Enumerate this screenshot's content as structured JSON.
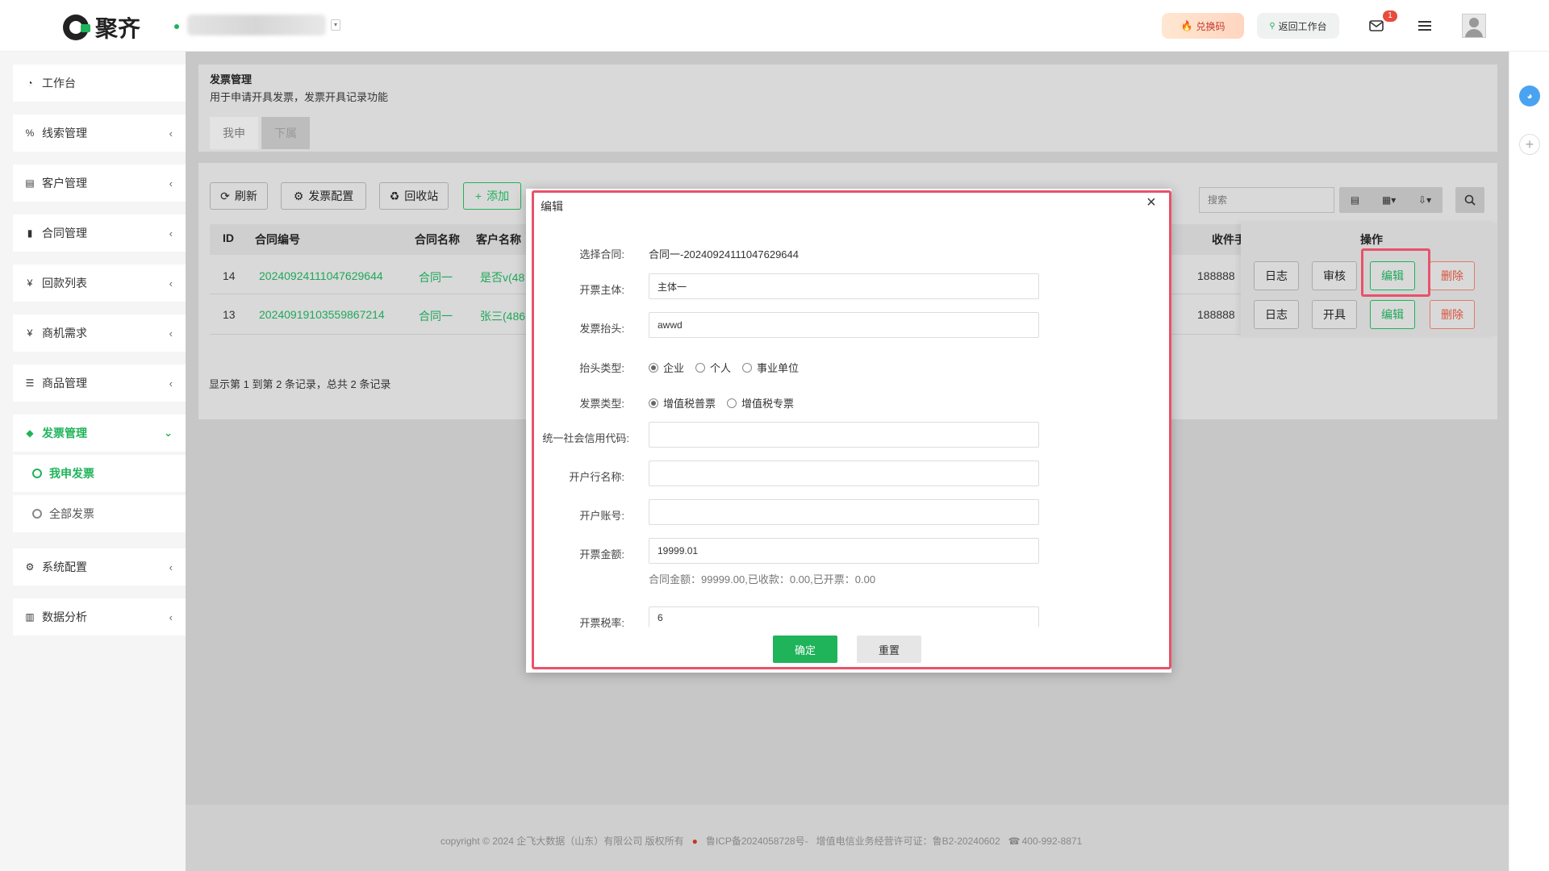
{
  "header": {
    "brand": "聚齐",
    "redeem_label": "兑换码",
    "back_label": "返回工作台",
    "mail_badge": "1"
  },
  "sidebar": {
    "items": [
      {
        "label": "工作台",
        "icon": "dashboard-icon"
      },
      {
        "label": "线索管理",
        "icon": "link-icon"
      },
      {
        "label": "客户管理",
        "icon": "id-card-icon"
      },
      {
        "label": "合同管理",
        "icon": "bookmark-icon"
      },
      {
        "label": "回款列表",
        "icon": "yen-icon"
      },
      {
        "label": "商机需求",
        "icon": "yen-icon"
      },
      {
        "label": "商品管理",
        "icon": "list-icon"
      },
      {
        "label": "发票管理",
        "icon": "tag-icon"
      },
      {
        "label": "系统配置",
        "icon": "gears-icon"
      },
      {
        "label": "数据分析",
        "icon": "bar-chart-icon"
      }
    ],
    "sub_items": [
      {
        "label": "我申发票"
      },
      {
        "label": "全部发票"
      }
    ]
  },
  "page": {
    "title": "发票管理",
    "subtitle": "用于申请开具发票，发票开具记录功能",
    "tabs": [
      "我申",
      "下属"
    ]
  },
  "toolbar": {
    "refresh": "刷新",
    "config": "发票配置",
    "recycle": "回收站",
    "add": "添加",
    "search_placeholder": "搜索"
  },
  "table": {
    "headers": [
      "ID",
      "合同编号",
      "合同名称",
      "客户名称",
      "收件手",
      "操作"
    ],
    "rows": [
      {
        "id": "14",
        "contract_no": "20240924111047629644",
        "contract_name": "合同一",
        "customer": "是否v(48",
        "receiver": "188888",
        "actions": [
          "日志",
          "审核",
          "编辑",
          "删除"
        ]
      },
      {
        "id": "13",
        "contract_no": "20240919103559867214",
        "contract_name": "合同一",
        "customer": "张三(486",
        "receiver": "188888",
        "actions": [
          "日志",
          "开具",
          "编辑",
          "删除"
        ]
      }
    ],
    "pagination": "显示第 1 到第 2 条记录，总共 2 条记录"
  },
  "modal": {
    "title": "编辑",
    "fields": {
      "contract_label": "选择合同:",
      "contract_value": "合同一-20240924111047629644",
      "subject_label": "开票主体:",
      "subject_value": "主体一",
      "heading_label": "发票抬头:",
      "heading_value": "awwd",
      "heading_type_label": "抬头类型:",
      "heading_type_options": [
        "企业",
        "个人",
        "事业单位"
      ],
      "invoice_type_label": "发票类型:",
      "invoice_type_options": [
        "增值税普票",
        "增值税专票"
      ],
      "credit_code_label": "统一社会信用代码:",
      "credit_code_value": "",
      "bank_name_label": "开户行名称:",
      "bank_name_value": "",
      "account_label": "开户账号:",
      "account_value": "",
      "amount_label": "开票金额:",
      "amount_value": "19999.01",
      "amount_hint": "合同金额：99999.00,已收款：0.00,已开票：0.00",
      "tax_label": "开票税率:",
      "tax_value": "6"
    },
    "ok_label": "确定",
    "reset_label": "重置"
  },
  "footer": {
    "text": "copyright © 2024 企飞大数据（山东）有限公司 版权所有",
    "icp": "鲁ICP备2024058728号-",
    "license": "增值电信业务经营许可证：鲁B2-20240602",
    "phone": "400-992-8871"
  },
  "colors": {
    "accent": "#1fb35a",
    "danger": "#d9533f",
    "highlight": "#e8526a"
  }
}
